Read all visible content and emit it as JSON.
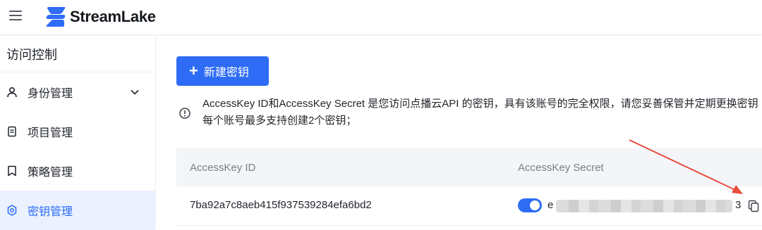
{
  "header": {
    "menu_icon": "hamburger-icon",
    "logo_text": "StreamLake",
    "logo_color": "#2e6cf6"
  },
  "sidebar": {
    "title": "访问控制",
    "items": [
      {
        "label": "身份管理",
        "icon": "user-icon",
        "expandable": true
      },
      {
        "label": "项目管理",
        "icon": "document-icon"
      },
      {
        "label": "策略管理",
        "icon": "bookmark-icon"
      },
      {
        "label": "密钥管理",
        "icon": "gear-icon",
        "active": true
      }
    ]
  },
  "main": {
    "new_key_button": "新建密钥",
    "notice_line1": "AccessKey ID和AccessKey Secret 是您访问点播云API 的密钥，具有该账号的完全权限，请您妥善保管并定期更换密钥",
    "notice_line2": "每个账号最多支持创建2个密钥；",
    "table": {
      "columns": [
        "AccessKey ID",
        "AccessKey Secret"
      ],
      "rows": [
        {
          "access_key_id": "7ba92a7c8aeb415f937539284efa6bd2",
          "secret_first_char": "e",
          "secret_last_char": "3",
          "toggle_on": true
        }
      ]
    }
  },
  "colors": {
    "accent": "#2e6cf6",
    "annotation_arrow": "#e84c3d"
  }
}
